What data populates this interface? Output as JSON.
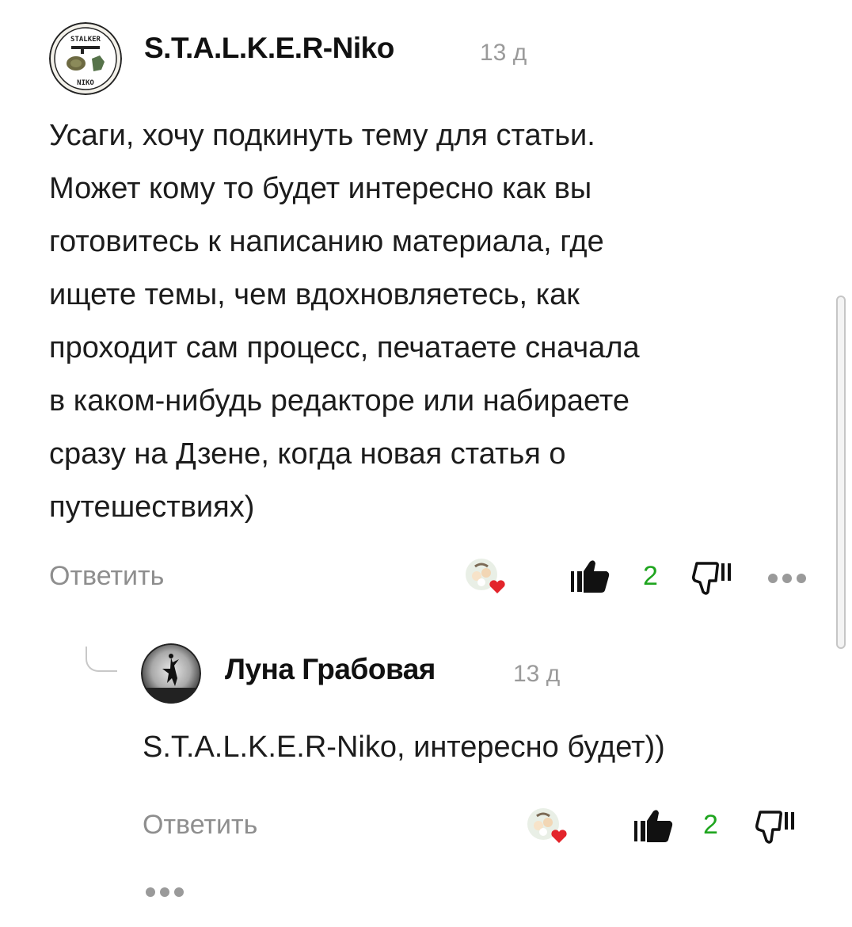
{
  "comments": [
    {
      "author": "S.T.A.L.K.E.R-Niko",
      "time": "13 д",
      "avatar_text_top": "STALKER",
      "avatar_text_bottom": "NIKO",
      "lines": [
        "Усаги, хочу подкинуть тему для статьи.",
        "Может кому то будет интересно как вы",
        "готовитесь к написанию материала, где",
        "ищете темы, чем вдохновляетесь, как",
        "проходит сам процесс, печатаете сначала",
        "в каком-нибудь редакторе или набираете",
        "сразу на Дзене, когда новая статья о",
        "путешествиях)"
      ],
      "reply_label": "Ответить",
      "likes": "2"
    },
    {
      "author": "Луна Грабовая",
      "time": "13 д",
      "lines": [
        "S.T.A.L.K.E.R-Niko, интересно будет))"
      ],
      "reply_label": "Ответить",
      "likes": "2"
    }
  ],
  "icons": {
    "like": "thumbs-up-icon",
    "dislike": "thumbs-down-icon",
    "more": "more-dots-icon",
    "liker_heart": "heart-icon"
  },
  "colors": {
    "like_count": "#1fa51f",
    "heart": "#e3242b",
    "muted": "#8e8e8e"
  }
}
